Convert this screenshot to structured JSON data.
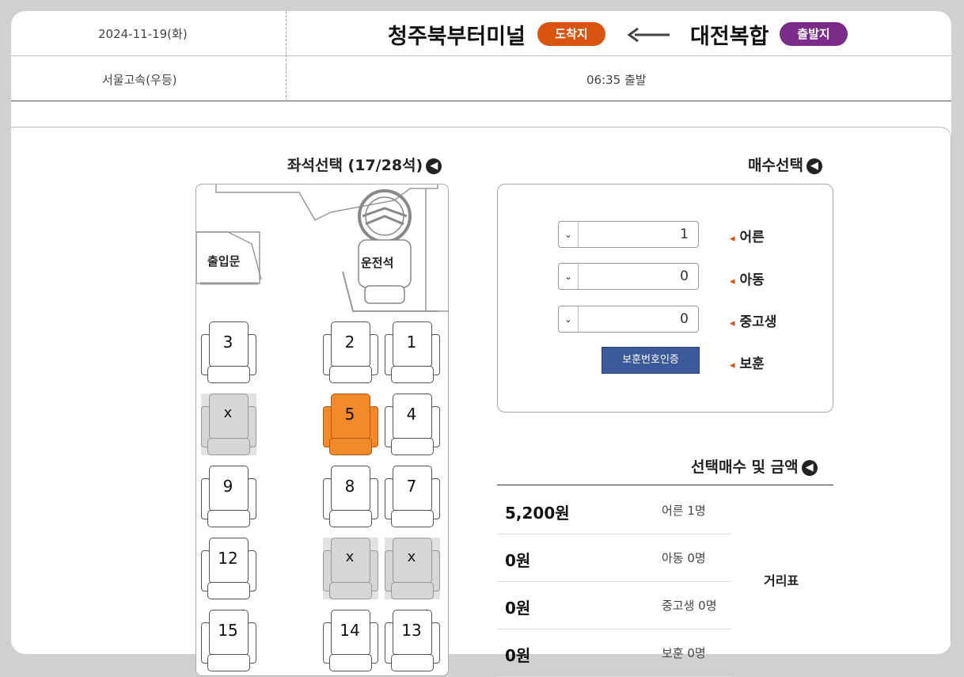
{
  "route": {
    "origin_badge": "출발지",
    "origin_name": "대전복합",
    "dest_badge": "도착지",
    "dest_name": "청주북부터미널",
    "date": "2024-11-19(화)",
    "depart_time": "06:35 출발",
    "company": "서울고속(우등)"
  },
  "seat_section": {
    "title": "좌석선택 (17/28석)",
    "driver_label": "운전석",
    "door_label": "출입문",
    "seats": [
      {
        "label": "1",
        "state": "available"
      },
      {
        "label": "2",
        "state": "available"
      },
      {
        "label": "3",
        "state": "available"
      },
      {
        "label": "4",
        "state": "available"
      },
      {
        "label": "5",
        "state": "selected"
      },
      {
        "label": "x",
        "state": "sold"
      },
      {
        "label": "7",
        "state": "available"
      },
      {
        "label": "8",
        "state": "available"
      },
      {
        "label": "9",
        "state": "available"
      },
      {
        "label": "x",
        "state": "sold"
      },
      {
        "label": "x",
        "state": "sold"
      },
      {
        "label": "12",
        "state": "available"
      },
      {
        "label": "13",
        "state": "available"
      },
      {
        "label": "14",
        "state": "available"
      },
      {
        "label": "15",
        "state": "available"
      }
    ]
  },
  "count_section": {
    "title": "매수선택",
    "adult_label": "어른",
    "adult_value": "1",
    "child_label": "아동",
    "child_value": "0",
    "student_label": "중고생",
    "student_value": "0",
    "veteran_label": "보훈",
    "veteran_button": "보훈번호인증"
  },
  "amount_section": {
    "title": "선택매수 및 금액",
    "side_label": "거리표",
    "rows": [
      {
        "type": "어른 1명",
        "money": "5,200원"
      },
      {
        "type": "아동 0명",
        "money": "0원"
      },
      {
        "type": "중고생 0명",
        "money": "0원"
      },
      {
        "type": "보훈 0명",
        "money": "0원"
      }
    ]
  },
  "colors": {
    "origin_badge": "#7b2c8a",
    "dest_badge": "#d9540f",
    "selected_seat": "#f28a2c",
    "button": "#3c5a9a"
  },
  "icons": [
    "arrow-left-icon",
    "chevron-circle-icon",
    "caret-down-icon",
    "steering-wheel-icon"
  ]
}
